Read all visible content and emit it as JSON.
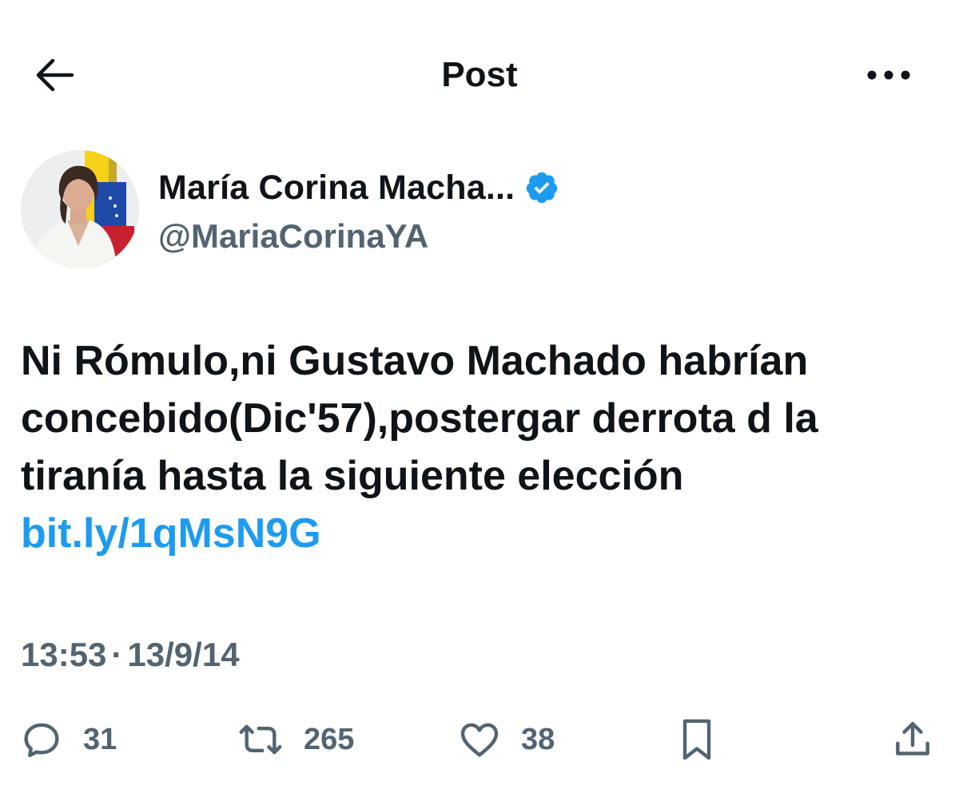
{
  "header": {
    "title": "Post",
    "back_icon": "arrow-left-icon",
    "more_icon": "more-horizontal-icon"
  },
  "author": {
    "display_name": "María Corina Macha...",
    "handle": "@MariaCorinaYA",
    "verified_color": "#1d9bf0"
  },
  "post": {
    "text": "Ni Rómulo,ni Gustavo Machado habrían concebido(Dic'57),postergar derrota d la tiranía hasta la siguiente elección ",
    "link": "bit.ly/1qMsN9G",
    "link_color": "#1d9bf0"
  },
  "meta": {
    "time": "13:53",
    "separator": "·",
    "date": "13/9/14"
  },
  "actions": {
    "replies": "31",
    "reposts": "265",
    "likes": "38"
  },
  "colors": {
    "text": "#0f1419",
    "secondary": "#536471",
    "accent": "#1d9bf0"
  }
}
